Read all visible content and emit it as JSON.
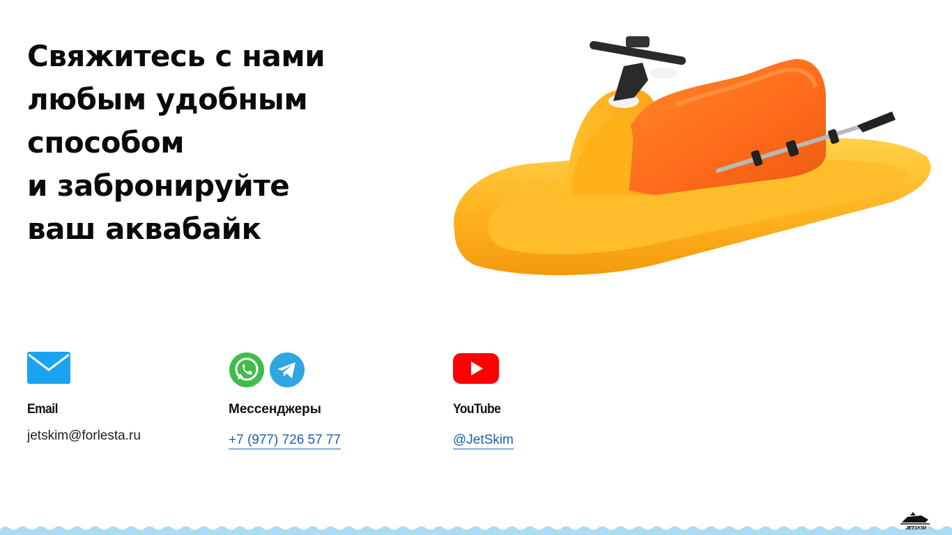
{
  "headline": {
    "lines": [
      "Свяжитесь с нами",
      "любым удобным",
      "способом",
      "и забронируйте",
      "ваш аквабайк"
    ]
  },
  "hero_image": {
    "subject": "inflatable-jetski",
    "colors": {
      "body": "#ffb21f",
      "seat": "#ff6a1a",
      "handlebar": "#2a2a2a"
    }
  },
  "contacts": {
    "email": {
      "icon": "envelope-icon",
      "title": "Email",
      "value": "jetskim@forlesta.ru",
      "icon_color": "#1aa3f0"
    },
    "messengers": {
      "icons": [
        "whatsapp-icon",
        "telegram-icon"
      ],
      "title": "Мессенджеры",
      "value": "+7 (977) 726 57 77",
      "whatsapp_color": "#3fbc4a",
      "telegram_color": "#2ea6e0"
    },
    "youtube": {
      "icon": "youtube-icon",
      "title": "YouTube",
      "value": "@JetSkim",
      "icon_color": "#ff0000"
    }
  },
  "footer": {
    "logo_text": "JETSKIM",
    "wave_color": "#a9dcf7"
  },
  "colors": {
    "link": "#1a5fb4",
    "text": "#111111",
    "background": "#ffffff"
  }
}
